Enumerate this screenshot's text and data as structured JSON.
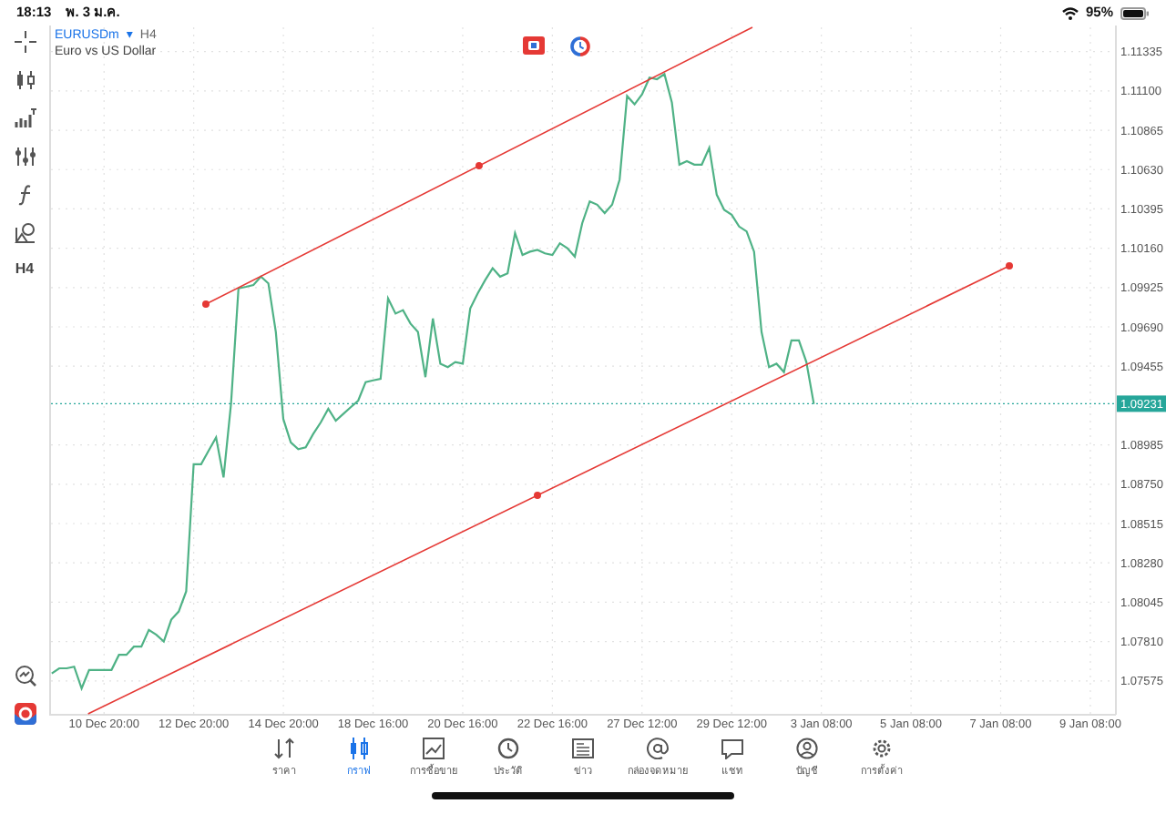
{
  "status_bar": {
    "time": "18:13",
    "date": "พ. 3 ม.ค.",
    "battery": "95%"
  },
  "symbol": {
    "name": "EURUSDm",
    "caret": "▾",
    "timeframe": "H4",
    "description": "Euro vs US Dollar"
  },
  "toolbar": {
    "timeframe": "H4"
  },
  "chart": {
    "current_price": "1.09231",
    "chart_data": {
      "type": "line",
      "categories": [
        null,
        null,
        null,
        null,
        null,
        null,
        null,
        "10 Dec 20:00",
        null,
        null,
        null,
        null,
        null,
        null,
        null,
        null,
        null,
        null,
        null,
        "12 Dec 20:00",
        null,
        null,
        null,
        null,
        null,
        null,
        null,
        null,
        null,
        null,
        null,
        "14 Dec 20:00",
        null,
        null,
        null,
        null,
        null,
        null,
        null,
        null,
        null,
        null,
        null,
        "18 Dec 16:00",
        null,
        null,
        null,
        null,
        null,
        null,
        null,
        null,
        null,
        null,
        null,
        "20 Dec 16:00",
        null,
        null,
        null,
        null,
        null,
        null,
        null,
        null,
        null,
        null,
        null,
        "22 Dec 16:00",
        null,
        null,
        null,
        null,
        null,
        null,
        null,
        null,
        null,
        null,
        null,
        "27 Dec 12:00",
        null,
        null,
        null,
        null,
        null,
        null,
        null,
        null,
        null,
        null,
        null,
        "29 Dec 12:00",
        null,
        null,
        null,
        null,
        null,
        null,
        null,
        null,
        null,
        null,
        null,
        "3 Jan 08:00",
        null,
        null,
        null,
        null,
        null,
        null,
        null,
        null,
        null,
        null,
        null,
        "5 Jan 08:00",
        null,
        null,
        null,
        null,
        null,
        null,
        null,
        null,
        null,
        null,
        null,
        "7 Jan 08:00",
        null,
        null,
        null,
        null,
        null,
        null,
        null,
        null,
        null,
        null,
        null,
        "9 Jan 08:00",
        null,
        null,
        null
      ],
      "series": [
        {
          "color": "#4fb286",
          "values": [
            1.0762,
            1.0765,
            1.0765,
            1.0766,
            1.0753,
            1.0764,
            1.0764,
            1.0764,
            1.0764,
            1.0773,
            1.0773,
            1.0778,
            1.0778,
            1.0788,
            1.0785,
            1.0781,
            1.0794,
            1.0799,
            1.0811,
            1.0887,
            1.0887,
            1.0895,
            1.0903,
            1.0879,
            1.0923,
            1.0992,
            1.0993,
            1.0994,
            1.0999,
            1.0995,
            1.0966,
            1.0914,
            1.09,
            1.0896,
            1.0897,
            1.0905,
            1.0912,
            1.092,
            1.0913,
            1.0917,
            1.0921,
            1.0925,
            1.0936,
            1.0937,
            1.0938,
            1.0986,
            1.0977,
            1.0979,
            1.0971,
            1.0966,
            1.0939,
            1.0974,
            1.0947,
            1.0945,
            1.0948,
            1.0947,
            1.098,
            1.0989,
            1.0997,
            1.1004,
            1.0999,
            1.1001,
            1.1025,
            1.1012,
            1.1014,
            1.1015,
            1.1013,
            1.1012,
            1.1019,
            1.1016,
            1.1011,
            1.1031,
            1.1044,
            1.1042,
            1.1037,
            1.1042,
            1.1057,
            1.1107,
            1.1102,
            1.1108,
            1.1118,
            1.1117,
            1.112,
            1.1103,
            1.1066,
            1.1068,
            1.1066,
            1.1066,
            1.1076,
            1.1048,
            1.1039,
            1.1036,
            1.1029,
            1.1026,
            1.1014,
            1.0966,
            1.0945,
            1.0947,
            1.0942,
            1.0961,
            1.0961,
            1.0948,
            1.0923,
            null,
            null,
            null,
            null,
            null,
            null,
            null,
            null,
            null,
            null,
            null,
            null,
            null,
            null,
            null,
            null,
            null,
            null,
            null,
            null,
            null,
            null,
            null,
            null,
            null,
            null,
            null,
            null,
            null,
            null,
            null,
            null,
            null,
            null,
            null,
            null,
            null,
            null,
            null,
            null
          ]
        }
      ],
      "ylim": [
        1.07378,
        1.1148
      ],
      "grid": true,
      "ref_lines": [
        {
          "axis": "y",
          "value": 1.09231,
          "color": "#26a69a"
        }
      ],
      "yticks": [
        {
          "value": 1.11335,
          "label": "1.11335"
        },
        {
          "value": 1.111,
          "label": "1.11100"
        },
        {
          "value": 1.10865,
          "label": "1.10865"
        },
        {
          "value": 1.1063,
          "label": "1.10630"
        },
        {
          "value": 1.10395,
          "label": "1.10395"
        },
        {
          "value": 1.1016,
          "label": "1.10160"
        },
        {
          "value": 1.09925,
          "label": "1.09925"
        },
        {
          "value": 1.0969,
          "label": "1.09690"
        },
        {
          "value": 1.09455,
          "label": "1.09455"
        },
        {
          "value": 1.08985,
          "label": "1.08985"
        },
        {
          "value": 1.0875,
          "label": "1.08750"
        },
        {
          "value": 1.08515,
          "label": "1.08515"
        },
        {
          "value": 1.0828,
          "label": "1.08280"
        },
        {
          "value": 1.08045,
          "label": "1.08045"
        },
        {
          "value": 1.0781,
          "label": "1.07810"
        },
        {
          "value": 1.07575,
          "label": "1.07575"
        }
      ]
    }
  },
  "tabs": [
    {
      "label": "ราคา",
      "selected": false
    },
    {
      "label": "กราฟ",
      "selected": true
    },
    {
      "label": "การซื้อขาย",
      "selected": false
    },
    {
      "label": "ประวัติ",
      "selected": false
    },
    {
      "label": "ข่าว",
      "selected": false
    },
    {
      "label": "กล่องจดหมาย",
      "selected": false
    },
    {
      "label": "แชท",
      "selected": false
    },
    {
      "label": "บัญชี",
      "selected": false
    },
    {
      "label": "การตั้งค่า",
      "selected": false
    }
  ]
}
